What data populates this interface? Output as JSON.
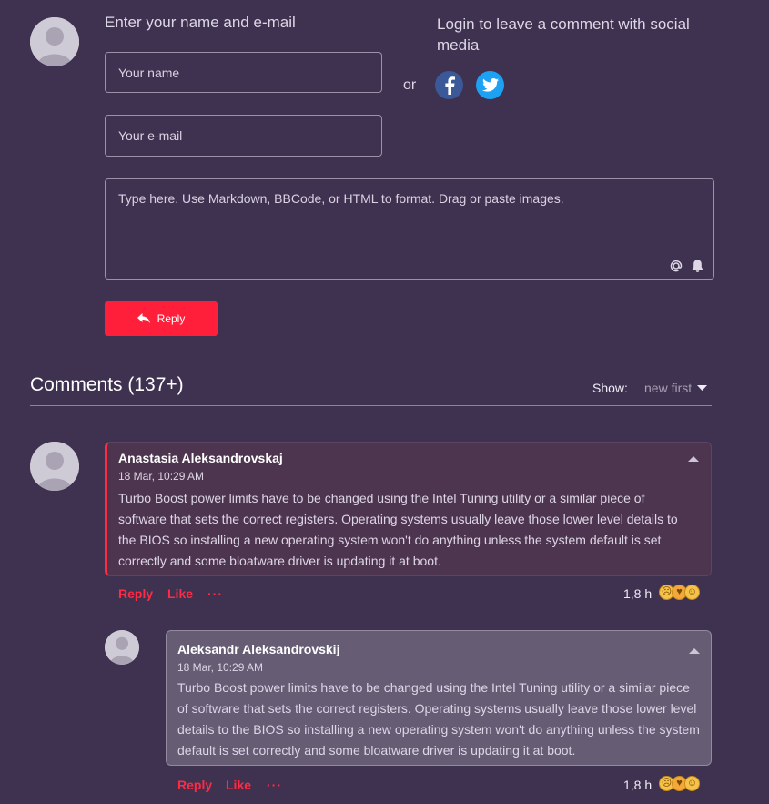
{
  "form": {
    "title": "Enter your name and e-mail",
    "name_placeholder": "Your name",
    "email_placeholder": "Your e-mail",
    "or_label": "or",
    "social_title": "Login to leave a comment with social media",
    "social": [
      "facebook",
      "twitter"
    ],
    "message_placeholder": "Type here. Use Markdown, BBCode, or HTML to format. Drag or paste images.",
    "reply_label": "Reply"
  },
  "comments_header": {
    "title": "Comments (137+)",
    "show_label": "Show:",
    "sort_value": "new first"
  },
  "comments": [
    {
      "author": "Anastasia Aleksandrovskaj",
      "time": "18 Mar, 10:29 AM",
      "text": "Turbo Boost power limits have to be changed using the Intel Tuning utility or a similar piece of software that sets the correct registers. Operating systems usually leave those lower level details to the BIOS so installing a new operating system won't do anything unless the system default is set correctly and some bloatware driver is updating it at boot.",
      "reply": "Reply",
      "like": "Like",
      "more": "···",
      "age": "1,8 h"
    },
    {
      "author": "Aleksandr Aleksandrovskij",
      "time": "18 Mar, 10:29 AM",
      "text": "Turbo Boost power limits have to be changed using the Intel Tuning utility or a similar piece of software that sets the correct registers. Operating systems usually leave those lower level details to the BIOS so installing a new operating system won't do anything unless the system default is set correctly and some bloatware driver is updating it at boot.",
      "reply": "Reply",
      "like": "Like",
      "more": "···",
      "age": "1,8 h"
    }
  ],
  "colors": {
    "background": "#3f3250",
    "accent": "#ff1f3b",
    "facebook": "#3b5998",
    "twitter": "#1da1f2"
  },
  "icons": [
    "user-avatar-icon",
    "facebook-icon",
    "twitter-icon",
    "at-icon",
    "bell-icon",
    "reply-arrow-icon",
    "caret-down-icon",
    "caret-up-icon",
    "reaction-emoji-icon"
  ]
}
